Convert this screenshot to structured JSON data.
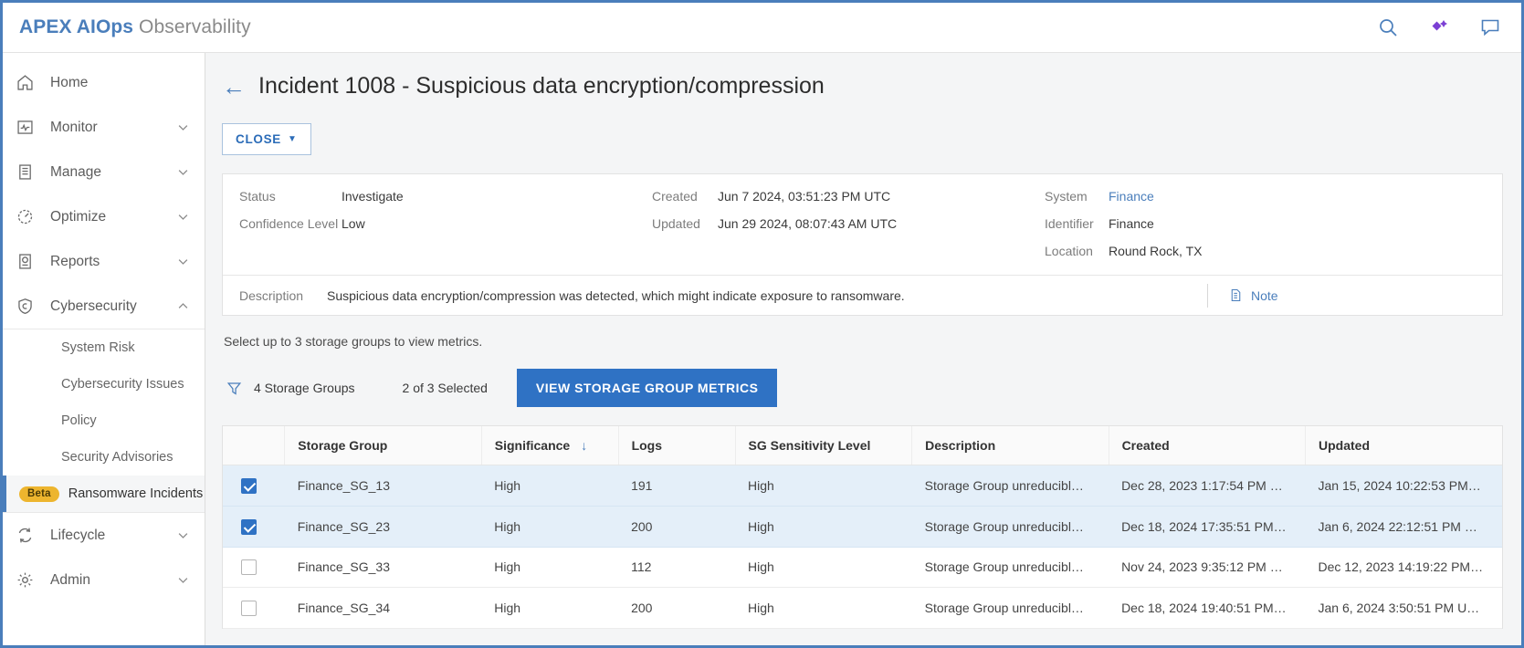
{
  "topbar": {
    "brand_bold": "APEX AIOps",
    "brand_light": " Observability",
    "icons": [
      "search-icon",
      "sparkle-icon",
      "chat-icon"
    ]
  },
  "sidebar": {
    "items": [
      {
        "label": "Home",
        "icon": "home-icon",
        "chevron": ""
      },
      {
        "label": "Monitor",
        "icon": "monitor-icon",
        "chevron": "down"
      },
      {
        "label": "Manage",
        "icon": "manage-icon",
        "chevron": "down"
      },
      {
        "label": "Optimize",
        "icon": "optimize-icon",
        "chevron": "down"
      },
      {
        "label": "Reports",
        "icon": "reports-icon",
        "chevron": "down"
      },
      {
        "label": "Cybersecurity",
        "icon": "shield-icon",
        "chevron": "up"
      }
    ],
    "sub_items": [
      {
        "label": "System Risk",
        "badge": "",
        "active": false
      },
      {
        "label": "Cybersecurity Issues",
        "badge": "",
        "active": false
      },
      {
        "label": "Policy",
        "badge": "",
        "active": false
      },
      {
        "label": "Security Advisories",
        "badge": "",
        "active": false
      },
      {
        "label": "Ransomware Incidents",
        "badge": "Beta",
        "active": true
      }
    ],
    "items_after": [
      {
        "label": "Lifecycle",
        "icon": "lifecycle-icon",
        "chevron": "down"
      },
      {
        "label": "Admin",
        "icon": "gear-icon",
        "chevron": "down"
      }
    ]
  },
  "page": {
    "back_arrow": "←",
    "title": "Incident 1008 - Suspicious data encryption/compression",
    "close_label": "CLOSE",
    "close_caret": "▼"
  },
  "details": {
    "left": [
      {
        "key": "Status",
        "value": "Investigate"
      },
      {
        "key": "Confidence Level",
        "value": "Low"
      }
    ],
    "middle": [
      {
        "key": "Created",
        "value": "Jun 7 2024, 03:51:23 PM UTC"
      },
      {
        "key": "Updated",
        "value": "Jun 29 2024, 08:07:43 AM UTC"
      }
    ],
    "right": [
      {
        "key": "System",
        "value": "Finance",
        "link": true
      },
      {
        "key": "Identifier",
        "value": "Finance",
        "link": false
      },
      {
        "key": "Location",
        "value": "Round Rock, TX",
        "link": false
      }
    ],
    "description_key": "Description",
    "description_value": "Suspicious data encryption/compression was detected, which might indicate exposure to ransomware.",
    "note_label": "Note"
  },
  "toolbar": {
    "hint": "Select up to 3 storage groups to view metrics.",
    "filter_label": "4 Storage Groups",
    "selected_label": "2 of 3 Selected",
    "primary_button": "VIEW STORAGE GROUP METRICS"
  },
  "table": {
    "columns": [
      "Storage Group",
      "Significance",
      "Logs",
      "SG Sensitivity Level",
      "Description",
      "Created",
      "Updated"
    ],
    "sorted_column": "Significance",
    "sort_direction": "↓",
    "rows": [
      {
        "checked": true,
        "storage_group": "Finance_SG_13",
        "significance": "High",
        "logs": "191",
        "sensitivity": "High",
        "description": "Storage Group unreducibl…",
        "created": "Dec 28, 2023 1:17:54 PM …",
        "updated": "Jan 15, 2024 10:22:53 PM…"
      },
      {
        "checked": true,
        "storage_group": "Finance_SG_23",
        "significance": "High",
        "logs": "200",
        "sensitivity": "High",
        "description": "Storage Group unreducibl…",
        "created": "Dec 18, 2024 17:35:51 PM…",
        "updated": "Jan 6, 2024 22:12:51 PM …"
      },
      {
        "checked": false,
        "storage_group": "Finance_SG_33",
        "significance": "High",
        "logs": "112",
        "sensitivity": "High",
        "description": "Storage Group unreducibl…",
        "created": "Nov 24, 2023 9:35:12 PM …",
        "updated": "Dec 12, 2023 14:19:22 PM…"
      },
      {
        "checked": false,
        "storage_group": "Finance_SG_34",
        "significance": "High",
        "logs": "200",
        "sensitivity": "High",
        "description": "Storage Group unreducibl…",
        "created": "Dec 18, 2024 19:40:51 PM…",
        "updated": "Jan 6, 2024 3:50:51 PM U…"
      }
    ]
  },
  "colors": {
    "brand_blue": "#4a7ebb",
    "primary_button": "#2f72c4",
    "selected_row": "#e4eff9",
    "beta_badge": "#edb52e"
  }
}
